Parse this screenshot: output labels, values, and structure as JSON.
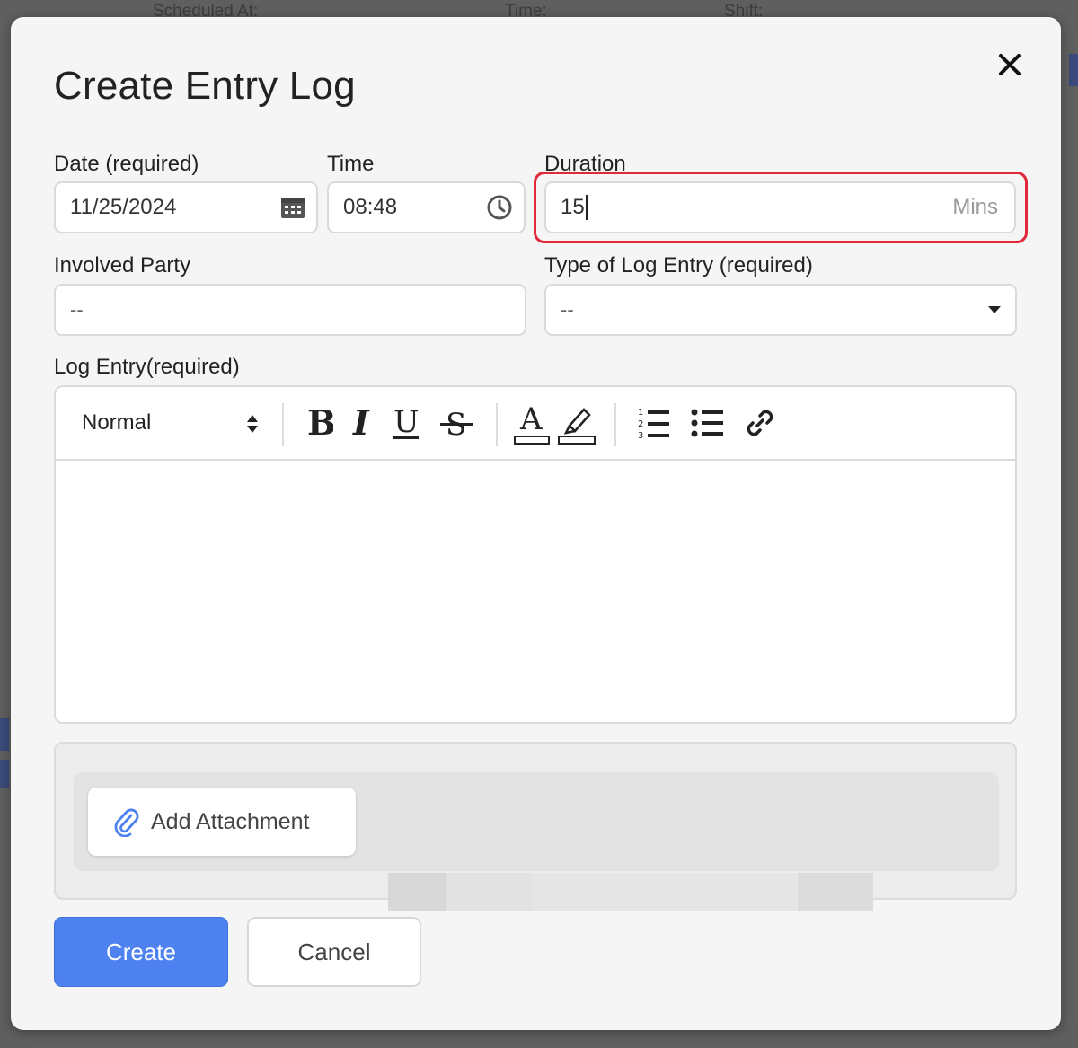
{
  "background": {
    "headers": [
      "Scheduled At:",
      "Time:",
      "Shift:"
    ]
  },
  "modal": {
    "title": "Create Entry Log",
    "close_icon": "close-icon"
  },
  "fields": {
    "date": {
      "label": "Date (required)",
      "value": "11/25/2024",
      "icon": "calendar-icon"
    },
    "time": {
      "label": "Time",
      "value": "08:48",
      "icon": "clock-icon"
    },
    "duration": {
      "label": "Duration",
      "value": "15",
      "suffix": "Mins",
      "highlight_color": "#e0283a"
    },
    "involved_party": {
      "label": "Involved Party",
      "placeholder": "--"
    },
    "type": {
      "label": "Type of Log Entry (required)",
      "value": "--",
      "icon": "caret-down-icon"
    }
  },
  "editor": {
    "label": "Log Entry(required)",
    "format_select": "Normal",
    "tools": [
      "bold",
      "italic",
      "underline",
      "strikethrough",
      "text-color",
      "highlight",
      "ordered-list",
      "bullet-list",
      "link"
    ],
    "content": ""
  },
  "attachment": {
    "button_label": "Add Attachment",
    "icon": "paperclip-icon"
  },
  "actions": {
    "create_label": "Create",
    "cancel_label": "Cancel",
    "primary_color": "#4d82f0"
  }
}
